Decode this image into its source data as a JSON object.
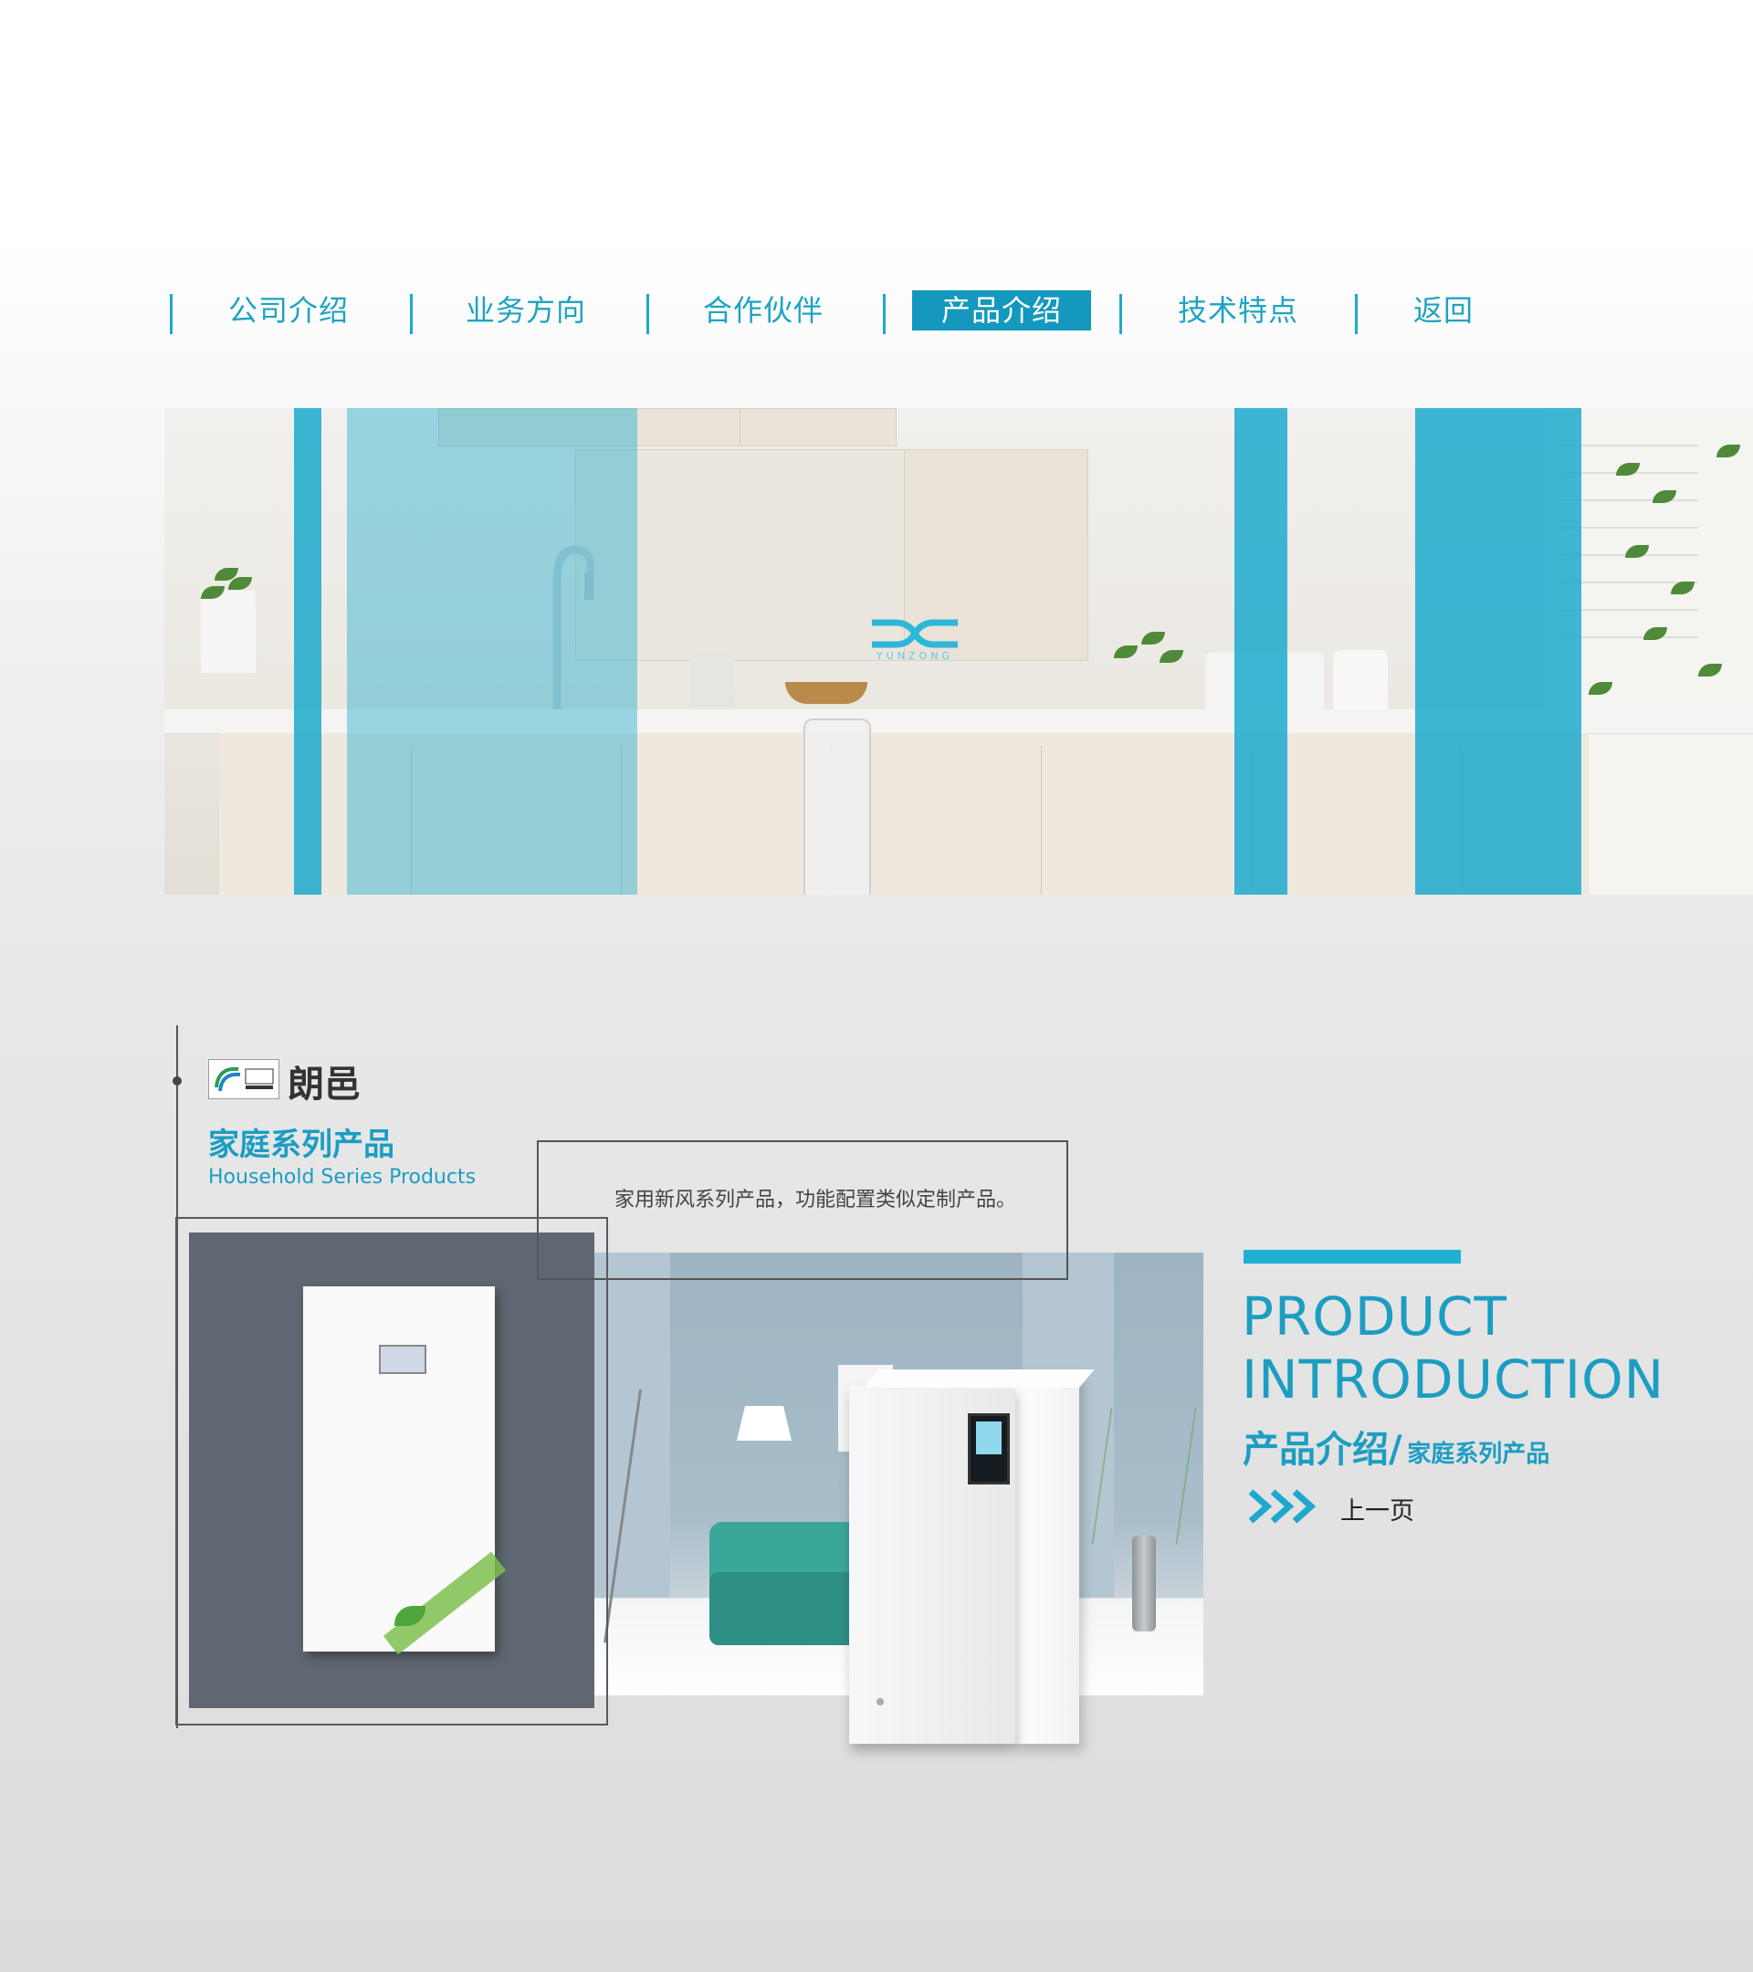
{
  "nav": {
    "items": [
      {
        "label": "公司介绍"
      },
      {
        "label": "业务方向"
      },
      {
        "label": "合作伙伴"
      },
      {
        "label": "产品介绍"
      },
      {
        "label": "技术特点"
      },
      {
        "label": "返回"
      }
    ],
    "active_index": 3,
    "accent_color": "#1ea3c3",
    "active_bg": "#1598bd"
  },
  "hero": {
    "logo_text": "YUNZONG",
    "logo_icon": "yunzong-logo-icon"
  },
  "brand": {
    "name": "朗邑",
    "logo_icon": "longyea-logo-icon",
    "series_cn": "家庭系列产品",
    "series_en": "Household Series Products"
  },
  "product": {
    "caption": "家用新风系列产品，功能配置类似定制产品。"
  },
  "intro": {
    "title_en_line1": "PRODUCT",
    "title_en_line2": "INTRODUCTION",
    "title_cn": "产品介绍/",
    "subtitle_cn": "家庭系列产品",
    "prev_label": "上一页",
    "prev_icon": "triple-chevron-right-icon",
    "accent_color": "#1eb0d2"
  }
}
